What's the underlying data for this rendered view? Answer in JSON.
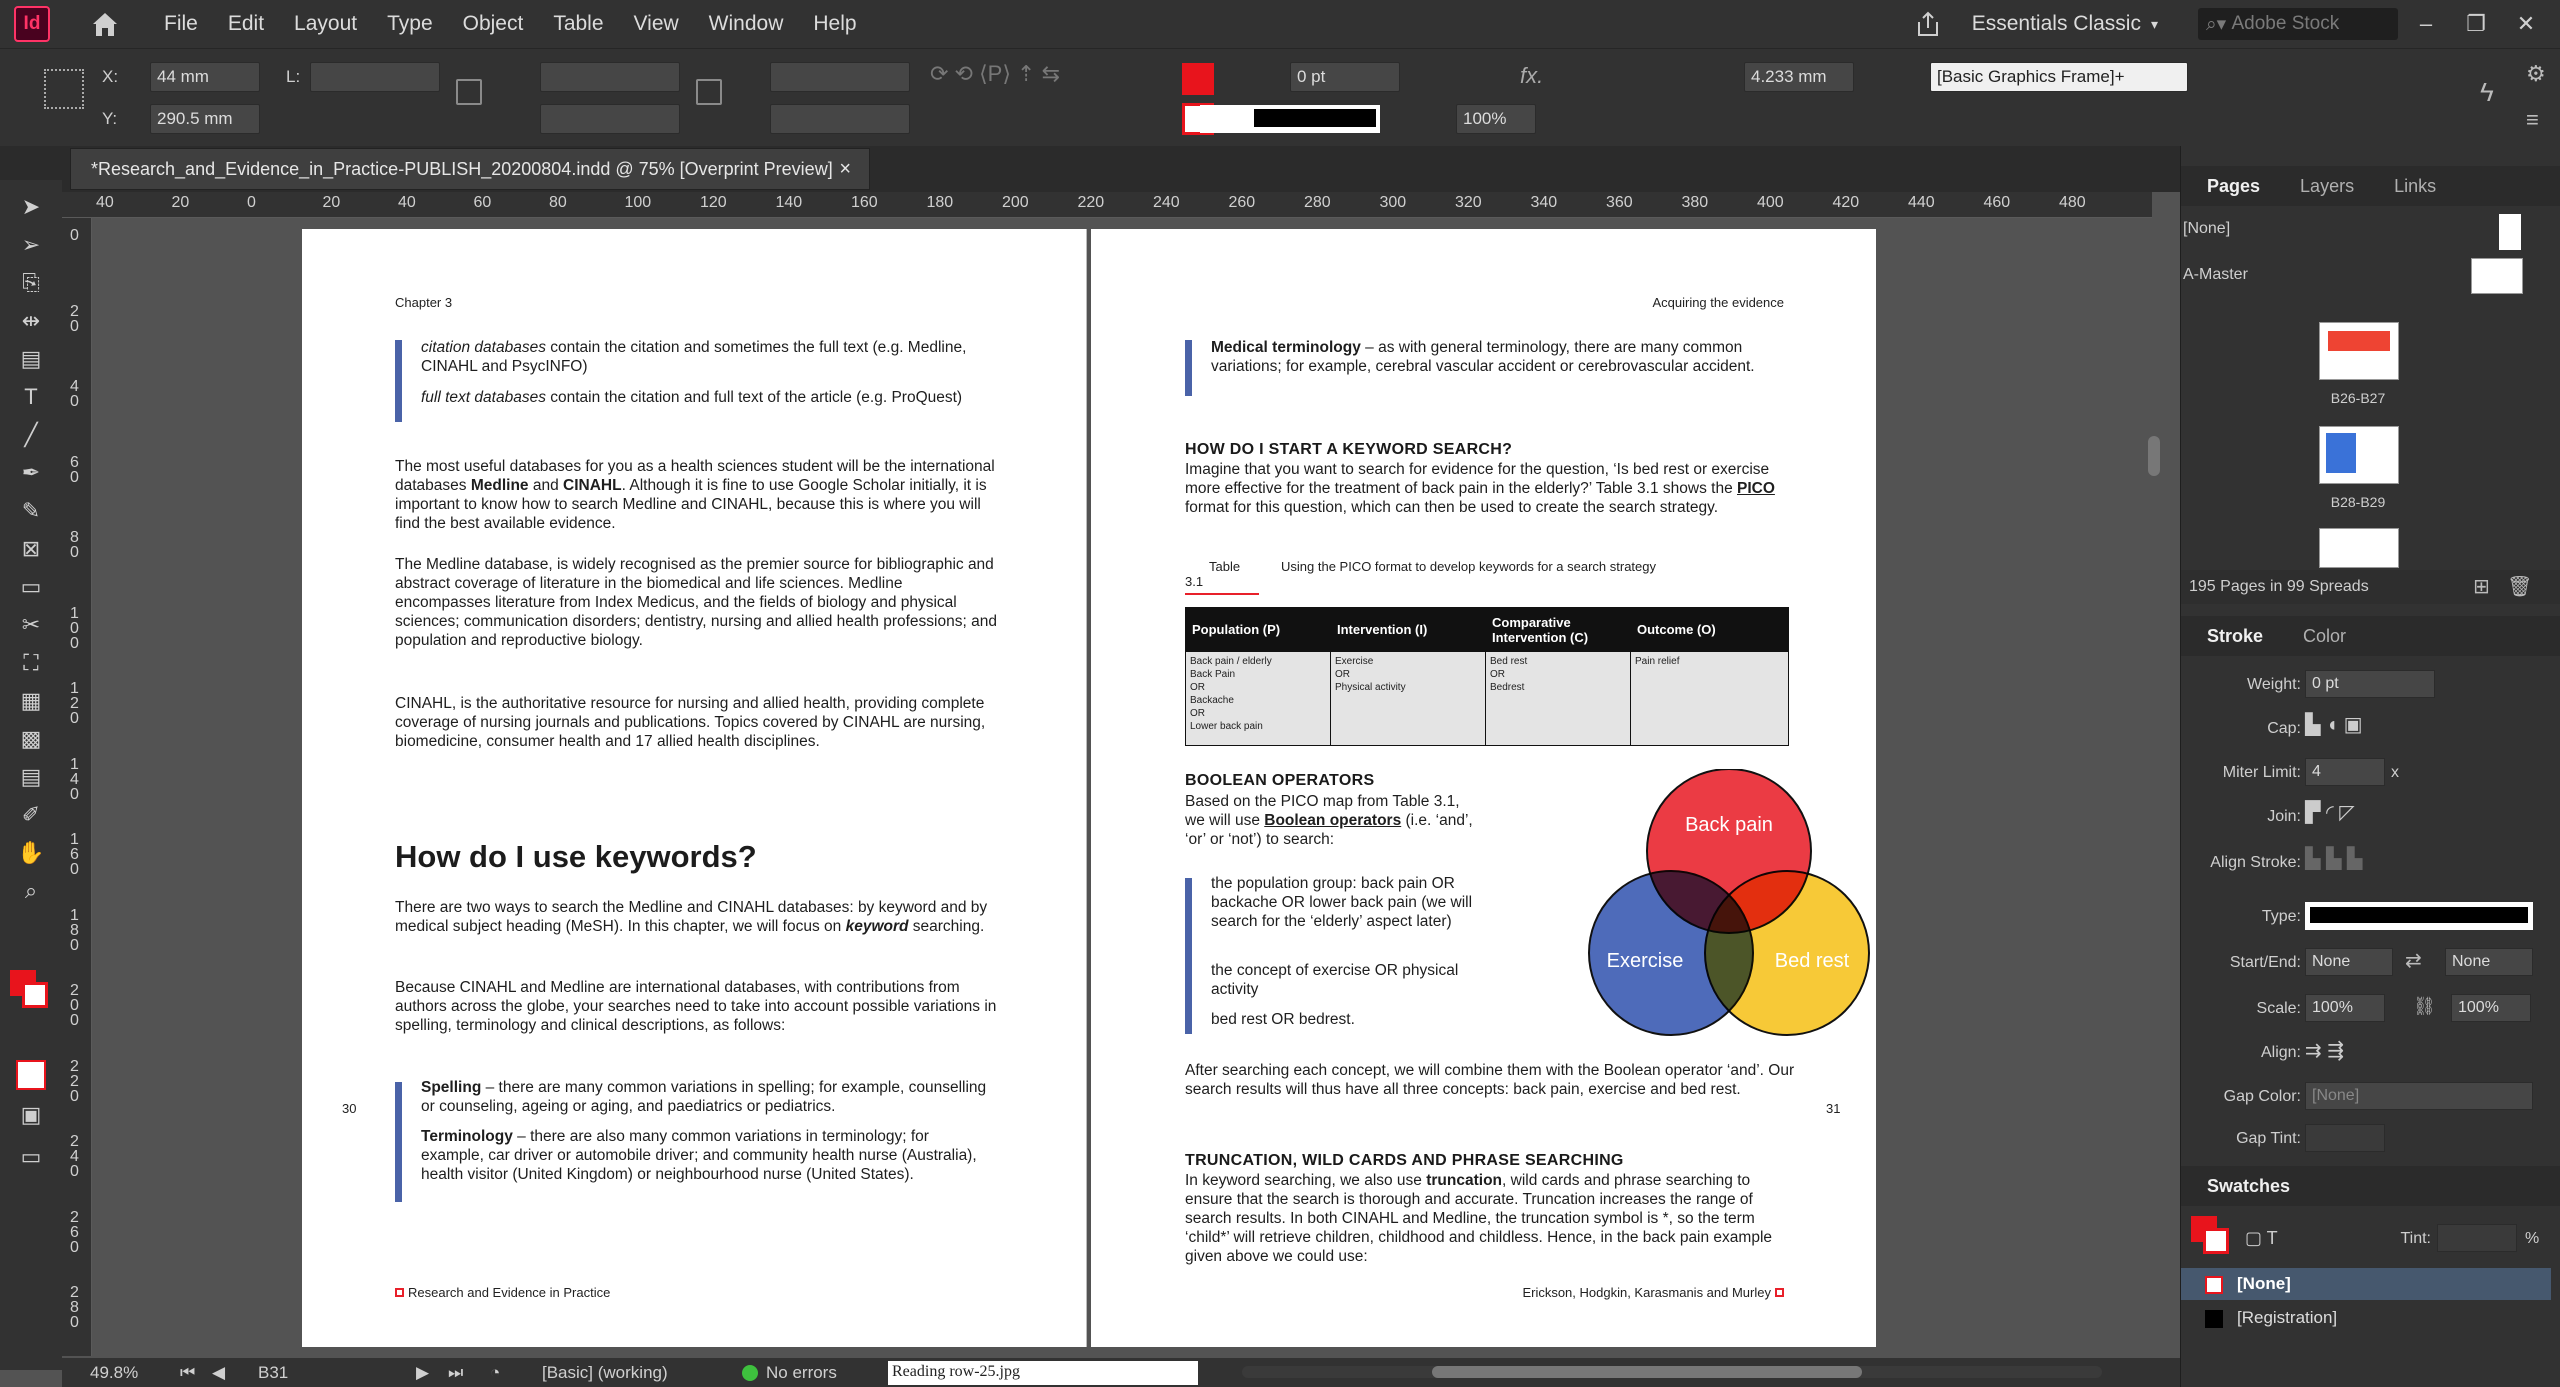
{
  "app": {
    "logo": "Id",
    "home_icon": "home-icon"
  },
  "menu": [
    "File",
    "Edit",
    "Layout",
    "Type",
    "Object",
    "Table",
    "View",
    "Window",
    "Help"
  ],
  "menubar_right": {
    "workspace": "Essentials Classic",
    "search_placeholder": "Adobe Stock"
  },
  "control": {
    "x_label": "X:",
    "x_value": "44 mm",
    "y_label": "Y:",
    "y_value": "290.5 mm",
    "l_label": "L:",
    "stroke_weight": "0 pt",
    "scale": "100%",
    "dimension": "4.233 mm",
    "frame_style": "[Basic Graphics Frame]+"
  },
  "document": {
    "tab_title": "*Research_and_Evidence_in_Practice-PUBLISH_20200804.indd @ 75% [Overprint Preview]",
    "close": "×"
  },
  "ruler_h": [
    "40",
    "20",
    "0",
    "20",
    "40",
    "60",
    "80",
    "100",
    "120",
    "140",
    "160",
    "180",
    "200",
    "220",
    "240",
    "260",
    "280",
    "300",
    "320",
    "340",
    "360",
    "380",
    "400",
    "420",
    "440",
    "460",
    "480"
  ],
  "ruler_v": [
    "0",
    "2 0",
    "4 0",
    "6 0",
    "8 0",
    "1 0 0",
    "1 2 0",
    "1 4 0",
    "1 6 0",
    "1 8 0",
    "2 0 0",
    "2 2 0",
    "2 4 0",
    "2 6 0",
    "2 8 0"
  ],
  "left_page": {
    "running_head": "Chapter 3",
    "bullet1_italic": "citation databases",
    "bullet1_rest": " contain the citation and sometimes the full text (e.g. Medline, CINAHL and PsycINFO)",
    "bullet2_italic": "full text databases",
    "bullet2_rest": " contain the citation and full text of the article (e.g. ProQuest)",
    "para1_a": "The most useful databases for you as a health sciences student will be the international databases ",
    "para1_b1": "Medline",
    "para1_c": " and ",
    "para1_b2": "CINAHL",
    "para1_d": ". Although it is fine to use Google Scholar initially, it is important to know how to search Medline and CINAHL, because this is where you will find the best available evidence.",
    "para2": "The Medline database, is widely recognised as the premier source for bibliographic and abstract coverage of literature in the biomedical and life sciences. Medline encompasses literature from Index Medicus, and the fields of biology and physical sciences; communication disorders; dentistry, nursing and allied health professions; and population and reproductive biology.",
    "para3": "CINAHL, is the authoritative resource for nursing and allied health, providing complete coverage of nursing journals and publications. Topics covered by CINAHL are nursing, biomedicine, consumer health and 17 allied health disciplines.",
    "heading": "How do I use keywords?",
    "para4_a": "There are two ways to search the Medline and CINAHL databases: by keyword and by medical subject heading (MeSH). In this chapter, we will focus on ",
    "para4_em": "keyword",
    "para4_b": " searching.",
    "para5": "Because CINAHL and Medline are international databases, with contributions from authors across the globe, your searches need to take into account possible variations in spelling, terminology and clinical descriptions, as follows:",
    "bullet3_b": "Spelling",
    "bullet3_rest": " – there are many common variations in spelling; for example, counselling or counseling, ageing or aging, and paediatrics or pediatrics.",
    "bullet4_b": "Terminology",
    "bullet4_rest": " – there are also many common variations in terminology; for example, car driver or automobile driver; and community health nurse (Australia), health visitor (United Kingdom) or neighbourhood nurse (United States).",
    "page_number": "30",
    "footer": "Research and Evidence in Practice"
  },
  "right_page": {
    "running_head": "Acquiring the evidence",
    "bullet1_b": "Medical terminology",
    "bullet1_rest": " – as with general terminology, there are many common variations; for example, cerebral vascular accident or cerebrovascular accident.",
    "h_keyword": "HOW DO I START A KEYWORD SEARCH?",
    "para1_a": "Imagine that you want to search for evidence for the question, ‘Is bed rest or exercise more effective for the treatment of back pain in the elderly?’ Table 3.1 shows the ",
    "para1_b": "PICO",
    "para1_c": " format for this question, which can then be used to create the search strategy.",
    "table_label": "Table 3.1",
    "table_caption": "Using the PICO format to develop keywords for a search strategy",
    "table_headers": [
      "Population (P)",
      "Intervention (I)",
      "Comparative Intervention (C)",
      "Outcome (O)"
    ],
    "table_cells": [
      [
        "Back pain / elderly",
        "",
        "Back Pain",
        "OR",
        "Backache",
        "OR",
        "Lower back pain"
      ],
      [
        "Exercise",
        "OR",
        "Physical activity"
      ],
      [
        "Bed rest",
        "OR",
        "Bedrest"
      ],
      [
        "Pain relief"
      ]
    ],
    "h_boolean": "BOOLEAN OPERATORS",
    "para2_a": "Based on the PICO map from Table 3.1, we will use ",
    "para2_b": "Boolean operators",
    "para2_c": " (i.e. ‘and’, ‘or’ or ‘not’) to search:",
    "bul_a": "the population group: back pain OR backache OR lower back pain (we will search for the ‘elderly’ aspect later)",
    "bul_b": "the concept of exercise OR physical activity",
    "bul_c": "bed rest OR bedrest.",
    "venn_labels": [
      "Back pain",
      "Exercise",
      "Bed rest"
    ],
    "venn_colors": [
      "#e8202a",
      "#3657b0",
      "#f6c21b"
    ],
    "para3": "After searching each concept, we will combine them with the Boolean operator ‘and’.  Our search results will thus have all three concepts: back pain, exercise and bed rest.",
    "h_trunc": "TRUNCATION, WILD CARDS AND PHRASE SEARCHING",
    "para4_a": "In keyword searching, we also use ",
    "para4_b": "truncation",
    "para4_c": ", wild cards and phrase searching to ensure that the search is thorough and accurate. Truncation increases the range of search results. In both CINAHL and Medline, the truncation symbol is *, so the term ‘child*’ will retrieve children, childhood and childless. Hence, in the back pain example given above we could use:",
    "page_number": "31",
    "footer": "Erickson, Hodgkin, Karasmanis and Murley"
  },
  "pages_panel": {
    "tabs": [
      "Pages",
      "Layers",
      "Links"
    ],
    "none": "[None]",
    "master": "A-Master",
    "spreads": [
      "B26-B27",
      "B28-B29"
    ],
    "summary": "195 Pages in 99 Spreads"
  },
  "stroke_panel": {
    "tabs": [
      "Stroke",
      "Color"
    ],
    "weight_label": "Weight:",
    "weight": "0 pt",
    "cap_label": "Cap:",
    "miter_label": "Miter Limit:",
    "miter": "4",
    "miter_unit": "x",
    "join_label": "Join:",
    "align_label": "Align Stroke:",
    "type_label": "Type:",
    "startend_label": "Start/End:",
    "start": "None",
    "end": "None",
    "scale_label": "Scale:",
    "scale1": "100%",
    "scale2": "100%",
    "align2_label": "Align:",
    "gapcolor_label": "Gap Color:",
    "gapcolor": "[None]",
    "gaptint_label": "Gap Tint:"
  },
  "swatches_panel": {
    "title": "Swatches",
    "tint_label": "Tint:",
    "tint_unit": "%",
    "items": [
      "[None]",
      "[Registration]"
    ]
  },
  "status": {
    "zoom": "49.8%",
    "page": "B31",
    "style": "[Basic] (working)",
    "errors": "No errors",
    "file": "Reading row-25.jpg"
  }
}
